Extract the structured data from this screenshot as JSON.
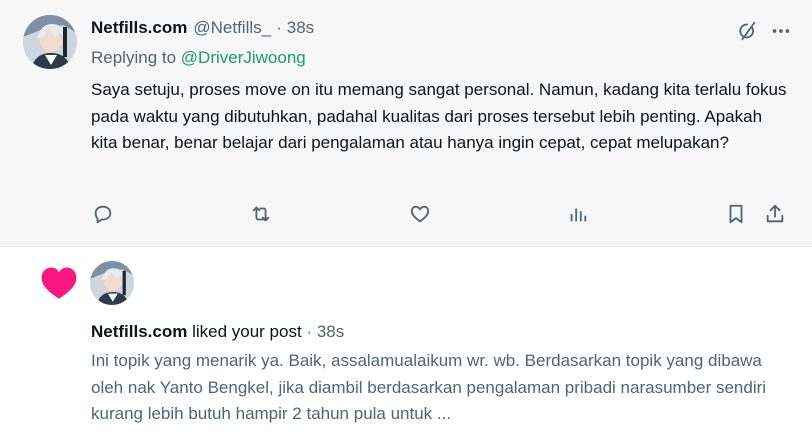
{
  "reply": {
    "display_name": "Netfills.com",
    "handle": "@Netfills_",
    "separator": "·",
    "time": "38s",
    "replying_prefix": "Replying to ",
    "replying_to": "@DriverJiwoong",
    "text": "Saya setuju, proses move on itu memang sangat personal. Namun, kadang kita terlalu fokus pada waktu yang dibutuhkan, padahal kualitas dari proses tersebut lebih penting. Apakah kita benar, benar belajar dari pengalaman atau hanya ingin cepat, cepat melupakan?",
    "icons": {
      "grok": "grok-icon",
      "more": "more-icon",
      "reply": "reply-icon",
      "repost": "repost-icon",
      "like": "like-icon",
      "views": "views-icon",
      "bookmark": "bookmark-icon",
      "share": "share-icon"
    }
  },
  "notification": {
    "icon": "heart-icon",
    "accent": "#f91880",
    "actor": "Netfills.com",
    "action": " liked your post",
    "separator": "·",
    "time": "38s",
    "preview": "Ini topik yang menarik ya. Baik, assalamualaikum wr. wb. Berdasarkan topik yang dibawa oleh nak Yanto Bengkel, jika diambil berdasarkan pengalaman pribadi narasumber sendiri kurang lebih butuh hampir 2 tahun pula untuk ..."
  },
  "colors": {
    "reply_background": "#f7f7f7",
    "mention": "#1d9b6f",
    "muted_text": "#536471",
    "primary_text": "#0f1419"
  }
}
